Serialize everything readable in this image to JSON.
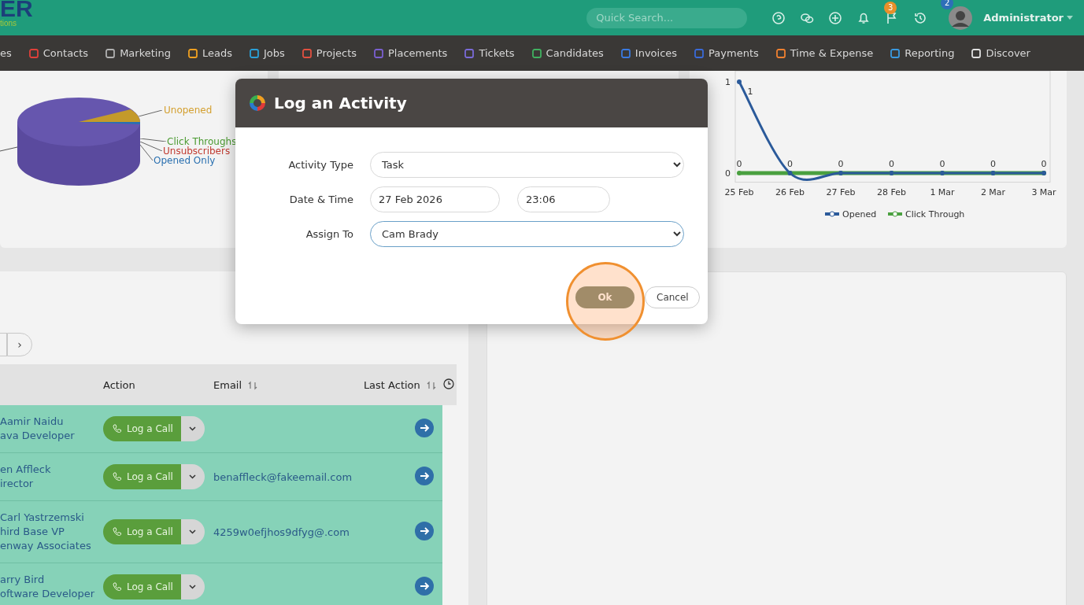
{
  "header": {
    "logo": {
      "mark": "ER",
      "tagline": "tions"
    },
    "search": {
      "placeholder": "Quick Search..."
    },
    "badges": [
      {
        "count": "3",
        "color": "#e8902a"
      },
      {
        "count": "2",
        "color": "#2e6fb8"
      }
    ],
    "user": "Administrator"
  },
  "nav": [
    {
      "label": "es"
    },
    {
      "label": "Contacts",
      "color": "#e0403a"
    },
    {
      "label": "Marketing",
      "color": "#b0b0b0"
    },
    {
      "label": "Leads",
      "color": "#f0a020"
    },
    {
      "label": "Jobs",
      "color": "#2aa0d8"
    },
    {
      "label": "Projects",
      "color": "#e05040"
    },
    {
      "label": "Placements",
      "color": "#7a5fd0"
    },
    {
      "label": "Tickets",
      "color": "#7a6ad8"
    },
    {
      "label": "Candidates",
      "color": "#40b060"
    },
    {
      "label": "Invoices",
      "color": "#3a7ae0"
    },
    {
      "label": "Payments",
      "color": "#3a6ad8"
    },
    {
      "label": "Time & Expense",
      "color": "#f08030"
    },
    {
      "label": "Reporting",
      "color": "#3a9ae0"
    },
    {
      "label": "Discover",
      "color": "#e0e0e0"
    }
  ],
  "pie": {
    "labels": [
      {
        "text": "Unopened",
        "color": "#d4a030"
      },
      {
        "text": "Click Throughs",
        "color": "#4a9a30"
      },
      {
        "text": "Unsubscribers",
        "color": "#c03a30"
      },
      {
        "text": "Opened Only",
        "color": "#2a70b0"
      }
    ]
  },
  "trend": {
    "chart_data": {
      "type": "line",
      "categories": [
        "25 Feb",
        "26 Feb",
        "27 Feb",
        "28 Feb",
        "1 Mar",
        "2 Mar",
        "3 Mar"
      ],
      "yticks": [
        0,
        1
      ],
      "ylim": [
        -0.1,
        1.12
      ],
      "legend": true,
      "series": [
        {
          "name": "Opened",
          "color": "#2b5a9a",
          "marker": true,
          "values": [
            1,
            0,
            0,
            0,
            0,
            0,
            0
          ],
          "value_labels": [
            "1",
            null,
            null,
            null,
            null,
            null,
            null
          ]
        },
        {
          "name": "Click Through",
          "color": "#4aa040",
          "marker": true,
          "values": [
            0,
            0,
            0,
            0,
            0,
            0,
            0
          ],
          "value_labels": [
            "0",
            "0",
            "0",
            "0",
            "0",
            "0",
            "0"
          ]
        }
      ]
    }
  },
  "table": {
    "pagination": {
      "next": "›"
    },
    "columns": [
      {
        "label": "Action",
        "sortable": false
      },
      {
        "label": "Email",
        "sortable": true
      },
      {
        "label": "Last Action",
        "sortable": true
      }
    ],
    "rows": [
      {
        "lines": [
          "Aamir Naidu",
          "ava Developer"
        ],
        "action": "Log a Call",
        "email": ""
      },
      {
        "lines": [
          "en Affleck",
          "irector"
        ],
        "action": "Log a Call",
        "email": "benaffleck@fakeemail.com"
      },
      {
        "lines": [
          "Carl Yastrzemski",
          "hird Base VP",
          "enway Associates"
        ],
        "action": "Log a Call",
        "email": "4259w0efjhos9dfyg@.com"
      },
      {
        "lines": [
          "arry Bird",
          "oftware Developer"
        ],
        "action": "Log a Call",
        "email": ""
      }
    ]
  },
  "modal": {
    "title": "Log an Activity",
    "fields": [
      {
        "label": "Activity Type",
        "kind": "select",
        "value": "Task",
        "focused": false
      },
      {
        "label": "Date & Time",
        "kind": "datetime",
        "value": "27 Feb 2026",
        "time": "23:06",
        "focused": false
      },
      {
        "label": "Assign To",
        "kind": "select",
        "value": "Cam Brady",
        "focused": true
      }
    ],
    "buttons": [
      {
        "label": "Ok",
        "kind": "primary"
      },
      {
        "label": "Cancel",
        "kind": "secondary"
      }
    ]
  }
}
